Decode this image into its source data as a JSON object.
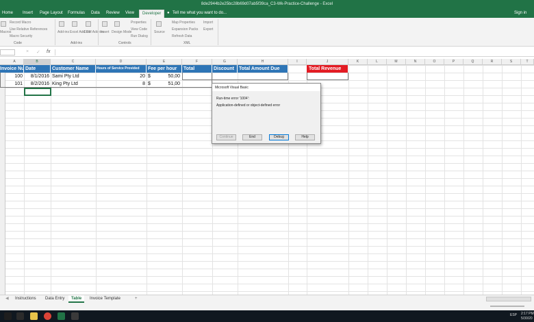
{
  "titlebar": {
    "title": "8de2944b2e25bc28b69d07ab5f39ca_C3-Wk-Practice-Challenge - Excel"
  },
  "ribbon_tabs": [
    "Home",
    "Insert",
    "Page Layout",
    "Formulas",
    "Data",
    "Review",
    "View",
    "Developer",
    "Tell me what you want to do..."
  ],
  "signin": "Sign in",
  "ribbon": {
    "code": {
      "label": "Code",
      "items": [
        "Record Macro",
        "Use Relative References",
        "Macro Security"
      ],
      "big": "Macros"
    },
    "addins": {
      "label": "Add-ins",
      "items": [
        "Add-ins",
        "Excel Add-ins",
        "COM Add-ins"
      ]
    },
    "controls": {
      "label": "Controls",
      "big1": "Insert",
      "big2": "Design Mode",
      "items": [
        "Properties",
        "View Code",
        "Run Dialog"
      ]
    },
    "xml": {
      "label": "XML",
      "big": "Source",
      "items": [
        "Map Properties",
        "Expansion Packs",
        "Refresh Data",
        "Import",
        "Export"
      ]
    }
  },
  "formula": {
    "fx": "fx",
    "cancel": "×",
    "enter": "✓"
  },
  "columns": [
    "A",
    "B",
    "C",
    "D",
    "E",
    "F",
    "G",
    "H",
    "I",
    "J",
    "K",
    "L",
    "M",
    "N",
    "O",
    "P",
    "Q",
    "R",
    "S",
    "T"
  ],
  "headers": {
    "a": "Invoice Number",
    "b": "Date",
    "c": "Customer Name",
    "d": "Hours of Service Provided",
    "e": "Fee per hour",
    "f": "Total",
    "g": "Discount",
    "h": "Total Amount Due",
    "j": "Total Revenue"
  },
  "rows": [
    {
      "invoice": "100",
      "date": "8/1/2016",
      "customer": "Sami Pty Ltd",
      "hours": "20",
      "cur": "$",
      "fee": "50,00"
    },
    {
      "invoice": "101",
      "date": "8/2/2016",
      "customer": "King Pty Ltd",
      "hours": "8",
      "cur": "$",
      "fee": "51,00"
    }
  ],
  "dialog": {
    "title": "Microsoft Visual Basic",
    "line1": "Run-time error '1004':",
    "line2": "Application-defined or object-defined error",
    "buttons": {
      "continue": "Continue",
      "end": "End",
      "debug": "Debug",
      "help": "Help"
    }
  },
  "sheets": [
    "Instructions",
    "Data Entry",
    "Table",
    "Invoice Template"
  ],
  "sheet_add": "+",
  "taskbar": {
    "time": "2:17 PM",
    "date": "5/30/20",
    "lang": "ESP"
  },
  "colors": {
    "excel_green": "#217346",
    "header_blue": "#2e75b6",
    "revenue_red": "#e31b23"
  }
}
